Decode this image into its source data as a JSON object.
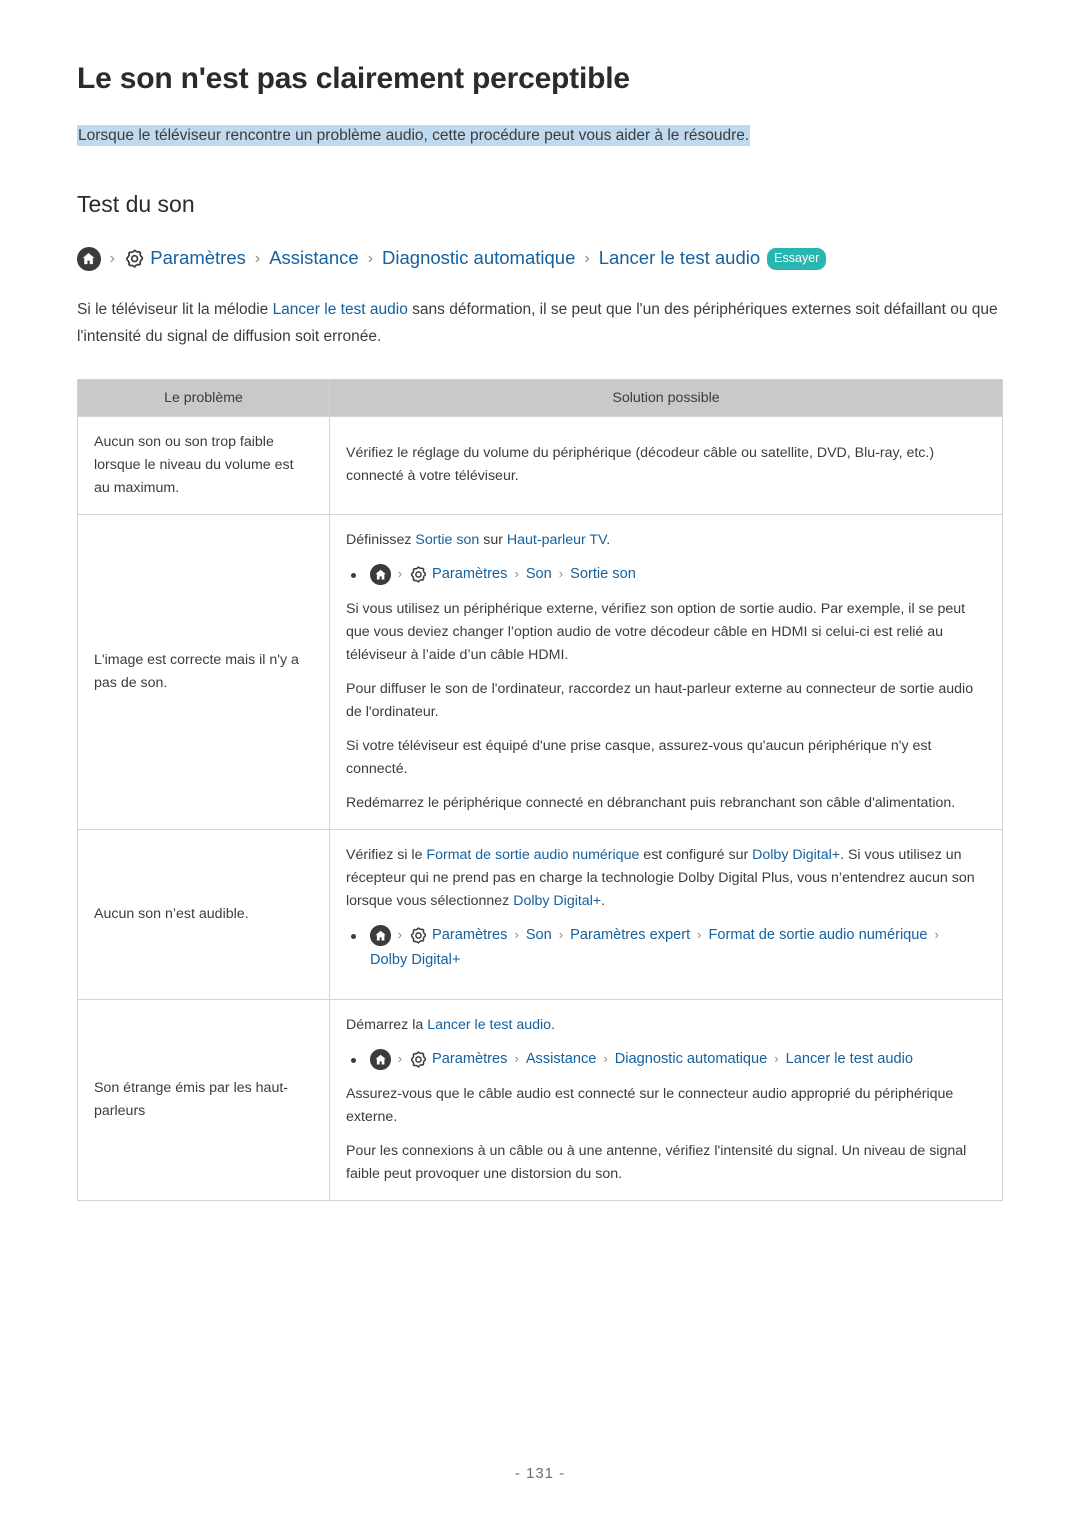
{
  "page": {
    "title": "Le son n'est pas clairement perceptible",
    "subtitle": "Lorsque le téléviseur rencontre un problème audio, cette procédure peut vous aider à le résoudre.",
    "page_number": "- 131 -"
  },
  "section": {
    "heading": "Test du son",
    "breadcrumb": {
      "home_icon": "home-icon",
      "gear_icon": "gear-icon",
      "separator": "›",
      "items": [
        "Paramètres",
        "Assistance",
        "Diagnostic automatique",
        "Lancer le test audio"
      ],
      "badge": "Essayer"
    },
    "intro": {
      "before_link": "Si le téléviseur lit la mélodie ",
      "link": "Lancer le test audio",
      "after_link": " sans déformation, il se peut que l'un des périphériques externes soit défaillant ou que l'intensité du signal de diffusion soit erronée."
    }
  },
  "table": {
    "headers": [
      "Le problème",
      "Solution possible"
    ],
    "rows": [
      {
        "problem": "Aucun son ou son trop faible lorsque le niveau du volume est au maximum.",
        "paragraphs": [
          {
            "segments": [
              {
                "text": "Vérifiez le réglage du volume du périphérique (décodeur câble ou satellite, DVD, Blu-ray, etc.) connecté à votre téléviseur.",
                "link": false
              }
            ]
          }
        ]
      },
      {
        "problem": "L'image est correcte mais il n'y a pas de son.",
        "paragraphs": [
          {
            "segments": [
              {
                "text": "Définissez ",
                "link": false
              },
              {
                "text": "Sortie son",
                "link": true
              },
              {
                "text": " sur ",
                "link": false
              },
              {
                "text": "Haut-parleur TV",
                "link": true
              },
              {
                "text": ".",
                "link": false
              }
            ]
          },
          {
            "breadcrumb": [
              "Paramètres",
              "Son",
              "Sortie son"
            ]
          },
          {
            "segments": [
              {
                "text": "Si vous utilisez un périphérique externe, vérifiez son option de sortie audio. Par exemple, il se peut que vous deviez changer l’option audio de votre décodeur câble en HDMI si celui-ci est relié au téléviseur à l’aide d’un câble HDMI.",
                "link": false
              }
            ]
          },
          {
            "segments": [
              {
                "text": "Pour diffuser le son de l'ordinateur, raccordez un haut-parleur externe au connecteur de sortie audio de l'ordinateur.",
                "link": false
              }
            ]
          },
          {
            "segments": [
              {
                "text": "Si votre téléviseur est équipé d'une prise casque, assurez-vous qu'aucun périphérique n'y est connecté.",
                "link": false
              }
            ]
          },
          {
            "segments": [
              {
                "text": "Redémarrez le périphérique connecté en débranchant puis rebranchant son câble d'alimentation.",
                "link": false
              }
            ]
          }
        ]
      },
      {
        "problem": "Aucun son n’est audible.",
        "paragraphs": [
          {
            "segments": [
              {
                "text": "Vérifiez si le ",
                "link": false
              },
              {
                "text": "Format de sortie audio numérique",
                "link": true
              },
              {
                "text": " est configuré sur ",
                "link": false
              },
              {
                "text": "Dolby Digital+",
                "link": true
              },
              {
                "text": ". Si vous utilisez un récepteur qui ne prend pas en charge la technologie Dolby Digital Plus, vous n’entendrez aucun son lorsque vous sélectionnez ",
                "link": false
              },
              {
                "text": "Dolby Digital+",
                "link": true
              },
              {
                "text": ".",
                "link": false
              }
            ]
          },
          {
            "breadcrumb": [
              "Paramètres",
              "Son",
              "Paramètres expert",
              "Format de sortie audio numérique",
              "Dolby Digital+"
            ]
          }
        ]
      },
      {
        "problem": "Son étrange émis par les haut-parleurs",
        "paragraphs": [
          {
            "segments": [
              {
                "text": "Démarrez la ",
                "link": false
              },
              {
                "text": "Lancer le test audio",
                "link": true
              },
              {
                "text": ".",
                "link": false
              }
            ]
          },
          {
            "breadcrumb": [
              "Paramètres",
              "Assistance",
              "Diagnostic automatique",
              "Lancer le test audio"
            ]
          },
          {
            "segments": [
              {
                "text": "Assurez-vous que le câble audio est connecté sur le connecteur audio approprié du périphérique externe.",
                "link": false
              }
            ]
          },
          {
            "segments": [
              {
                "text": "Pour les connexions à un câble ou à une antenne, vérifiez l'intensité du signal. Un niveau de signal faible peut provoquer une distorsion du son.",
                "link": false
              }
            ]
          }
        ]
      }
    ]
  },
  "colors": {
    "link_blue": "#15619f",
    "highlight_blue": "#bfd9ef",
    "badge_teal": "#27b6b0",
    "table_header_gray": "#c9c9c9",
    "table_border": "#d4d4d4",
    "text": "#3c3c3c"
  }
}
